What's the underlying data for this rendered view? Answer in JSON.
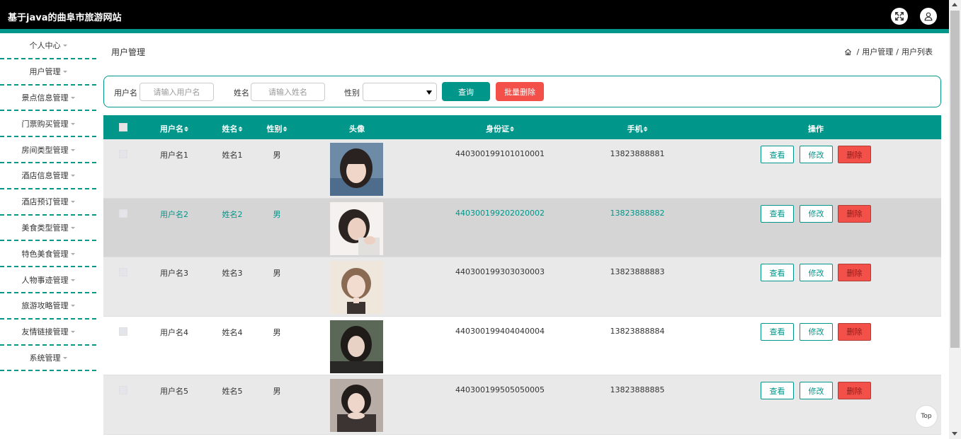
{
  "app": {
    "title": "基于java的曲阜市旅游网站"
  },
  "sidebar": {
    "items": [
      {
        "label": "个人中心"
      },
      {
        "label": "用户管理"
      },
      {
        "label": "景点信息管理"
      },
      {
        "label": "门票购买管理"
      },
      {
        "label": "房间类型管理"
      },
      {
        "label": "酒店信息管理"
      },
      {
        "label": "酒店预订管理"
      },
      {
        "label": "美食类型管理"
      },
      {
        "label": "特色美食管理"
      },
      {
        "label": "人物事迹管理"
      },
      {
        "label": "旅游攻略管理"
      },
      {
        "label": "友情链接管理"
      },
      {
        "label": "系统管理"
      }
    ]
  },
  "page": {
    "title": "用户管理"
  },
  "breadcrumb": {
    "parent": "用户管理",
    "current": "用户列表",
    "separator": "/"
  },
  "search": {
    "username_label": "用户名",
    "username_placeholder": "请输入用户名",
    "name_label": "姓名",
    "name_placeholder": "请输入姓名",
    "gender_label": "性别",
    "gender_value": "",
    "query_label": "查询",
    "batch_delete_label": "批量删除"
  },
  "table": {
    "headers": {
      "username": "用户名",
      "name": "姓名",
      "gender": "性别",
      "avatar": "头像",
      "idcard": "身份证",
      "phone": "手机",
      "actions": "操作"
    },
    "actions": {
      "view": "查看",
      "edit": "修改",
      "delete": "删除"
    },
    "rows": [
      {
        "username": "用户名1",
        "name": "姓名1",
        "gender": "男",
        "idcard": "440300199101010001",
        "phone": "13823888881"
      },
      {
        "username": "用户名2",
        "name": "姓名2",
        "gender": "男",
        "idcard": "440300199202020002",
        "phone": "13823888882"
      },
      {
        "username": "用户名3",
        "name": "姓名3",
        "gender": "男",
        "idcard": "440300199303030003",
        "phone": "13823888883"
      },
      {
        "username": "用户名4",
        "name": "姓名4",
        "gender": "男",
        "idcard": "440300199404040004",
        "phone": "13823888884"
      },
      {
        "username": "用户名5",
        "name": "姓名5",
        "gender": "男",
        "idcard": "440300199505050005",
        "phone": "13823888885"
      }
    ]
  },
  "floater": {
    "top_label": "Top"
  },
  "colors": {
    "accent": "#00968a",
    "danger": "#f3504a",
    "header": "#000000"
  }
}
